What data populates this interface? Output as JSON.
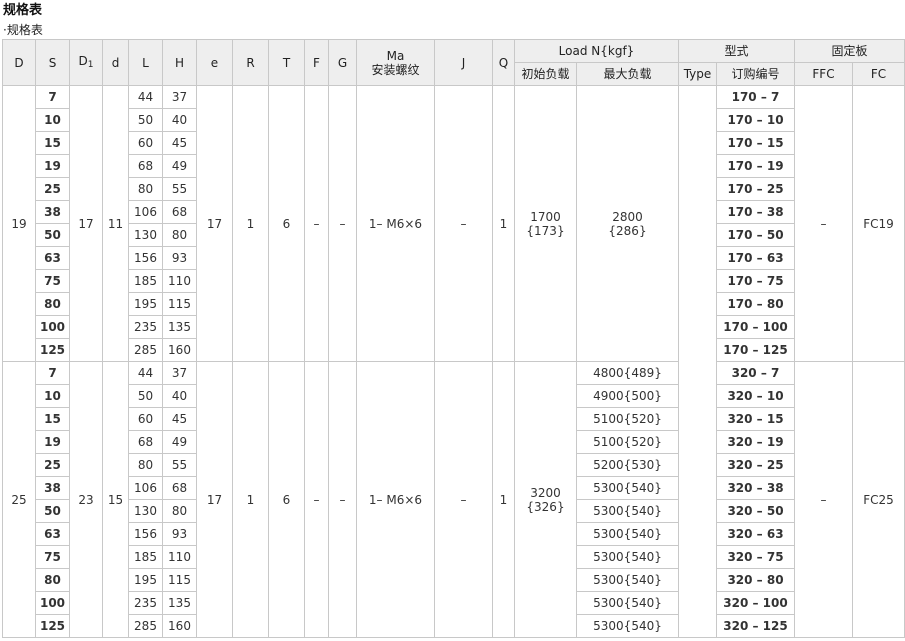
{
  "title": "规格表",
  "subtitle": "·规格表",
  "header": {
    "D": "D",
    "S": "S",
    "D1_main": "D",
    "D1_sub": "1",
    "d": "d",
    "L": "L",
    "H": "H",
    "e": "e",
    "R": "R",
    "T": "T",
    "F": "F",
    "G": "G",
    "Ma": "Ma",
    "Ma_sub": "安装螺纹",
    "J": "J",
    "Q": "Q",
    "load": "Load N{kgf}",
    "load_initial": "初始负载",
    "load_max": "最大负载",
    "model": "型式",
    "type": "Type",
    "order_no": "订购编号",
    "fixing": "固定板",
    "FFC": "FFC",
    "FC": "FC"
  },
  "groups": [
    {
      "D": "19",
      "D1": "17",
      "d": "11",
      "e": "17",
      "R": "1",
      "T": "6",
      "F": "–",
      "G": "–",
      "Ma": "1– M6×6",
      "J": "–",
      "Q": "1",
      "initial_load": "1700",
      "initial_load_kgf": "{173}",
      "max_load": "2800",
      "max_load_kgf": "{286}",
      "FFC": "–",
      "FC": "FC19",
      "rows": [
        {
          "S": "7",
          "L": "44",
          "H": "37",
          "order": "170 – 7"
        },
        {
          "S": "10",
          "L": "50",
          "H": "40",
          "order": "170 – 10"
        },
        {
          "S": "15",
          "L": "60",
          "H": "45",
          "order": "170 – 15"
        },
        {
          "S": "19",
          "L": "68",
          "H": "49",
          "order": "170 – 19"
        },
        {
          "S": "25",
          "L": "80",
          "H": "55",
          "order": "170 – 25"
        },
        {
          "S": "38",
          "L": "106",
          "H": "68",
          "order": "170 – 38"
        },
        {
          "S": "50",
          "L": "130",
          "H": "80",
          "order": "170 – 50"
        },
        {
          "S": "63",
          "L": "156",
          "H": "93",
          "order": "170 – 63"
        },
        {
          "S": "75",
          "L": "185",
          "H": "110",
          "order": "170 – 75"
        },
        {
          "S": "80",
          "L": "195",
          "H": "115",
          "order": "170 – 80"
        },
        {
          "S": "100",
          "L": "235",
          "H": "135",
          "order": "170 – 100"
        },
        {
          "S": "125",
          "L": "285",
          "H": "160",
          "order": "170 – 125"
        }
      ]
    },
    {
      "D": "25",
      "D1": "23",
      "d": "15",
      "e": "17",
      "R": "1",
      "T": "6",
      "F": "–",
      "G": "–",
      "Ma": "1– M6×6",
      "J": "–",
      "Q": "1",
      "initial_load": "3200",
      "initial_load_kgf": "{326}",
      "FFC": "–",
      "FC": "FC25",
      "rows": [
        {
          "S": "7",
          "L": "44",
          "H": "37",
          "max": "4800{489}",
          "order": "320 – 7"
        },
        {
          "S": "10",
          "L": "50",
          "H": "40",
          "max": "4900{500}",
          "order": "320 – 10"
        },
        {
          "S": "15",
          "L": "60",
          "H": "45",
          "max": "5100{520}",
          "order": "320 – 15"
        },
        {
          "S": "19",
          "L": "68",
          "H": "49",
          "max": "5100{520}",
          "order": "320 – 19"
        },
        {
          "S": "25",
          "L": "80",
          "H": "55",
          "max": "5200{530}",
          "order": "320 – 25"
        },
        {
          "S": "38",
          "L": "106",
          "H": "68",
          "max": "5300{540}",
          "order": "320 – 38"
        },
        {
          "S": "50",
          "L": "130",
          "H": "80",
          "max": "5300{540}",
          "order": "320 – 50"
        },
        {
          "S": "63",
          "L": "156",
          "H": "93",
          "max": "5300{540}",
          "order": "320 – 63"
        },
        {
          "S": "75",
          "L": "185",
          "H": "110",
          "max": "5300{540}",
          "order": "320 – 75"
        },
        {
          "S": "80",
          "L": "195",
          "H": "115",
          "max": "5300{540}",
          "order": "320 – 80"
        },
        {
          "S": "100",
          "L": "235",
          "H": "135",
          "max": "5300{540}",
          "order": "320 – 100"
        },
        {
          "S": "125",
          "L": "285",
          "H": "160",
          "max": "5300{540}",
          "order": "320 – 125"
        }
      ]
    }
  ]
}
